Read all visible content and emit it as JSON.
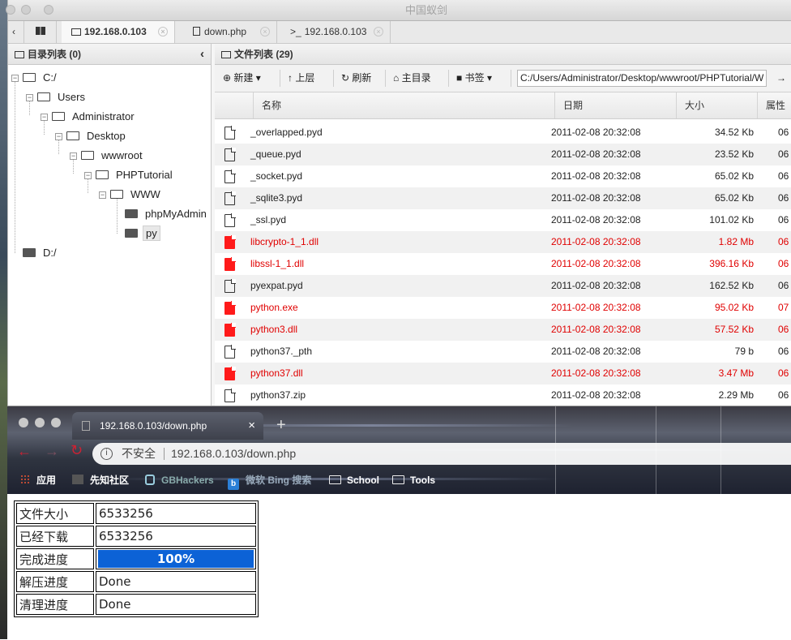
{
  "antsword": {
    "title": "中国蚁剑",
    "tabs": [
      {
        "label": "192.168.0.103"
      },
      {
        "label": "down.php"
      },
      {
        "label": "192.168.0.103"
      }
    ],
    "dir_panel": {
      "title": "目录列表 (0)",
      "tree": [
        {
          "label": "C:/"
        },
        {
          "label": "Users"
        },
        {
          "label": "Administrator"
        },
        {
          "label": "Desktop"
        },
        {
          "label": "wwwroot"
        },
        {
          "label": "PHPTutorial"
        },
        {
          "label": "WWW"
        },
        {
          "label": "phpMyAdmin"
        },
        {
          "label": "py"
        },
        {
          "label": "D:/"
        }
      ]
    },
    "file_panel": {
      "title": "文件列表 (29)",
      "toolbar": {
        "new_label": "新建",
        "up_label": "上层",
        "refresh_label": "刷新",
        "home_label": "主目录",
        "bookmark_label": "书签",
        "path": "C:/Users/Administrator/Desktop/wwwroot/PHPTutorial/W"
      },
      "columns": [
        "名称",
        "日期",
        "大小",
        "属性"
      ],
      "files": [
        {
          "name": "_overlapped.pyd",
          "date": "2011-02-08 20:32:08",
          "size": "34.52 Kb",
          "attr": "06",
          "red": false
        },
        {
          "name": "_queue.pyd",
          "date": "2011-02-08 20:32:08",
          "size": "23.52 Kb",
          "attr": "06",
          "red": false
        },
        {
          "name": "_socket.pyd",
          "date": "2011-02-08 20:32:08",
          "size": "65.02 Kb",
          "attr": "06",
          "red": false
        },
        {
          "name": "_sqlite3.pyd",
          "date": "2011-02-08 20:32:08",
          "size": "65.02 Kb",
          "attr": "06",
          "red": false
        },
        {
          "name": "_ssl.pyd",
          "date": "2011-02-08 20:32:08",
          "size": "101.02 Kb",
          "attr": "06",
          "red": false
        },
        {
          "name": "libcrypto-1_1.dll",
          "date": "2011-02-08 20:32:08",
          "size": "1.82 Mb",
          "attr": "06",
          "red": true
        },
        {
          "name": "libssl-1_1.dll",
          "date": "2011-02-08 20:32:08",
          "size": "396.16 Kb",
          "attr": "06",
          "red": true
        },
        {
          "name": "pyexpat.pyd",
          "date": "2011-02-08 20:32:08",
          "size": "162.52 Kb",
          "attr": "06",
          "red": false
        },
        {
          "name": "python.exe",
          "date": "2011-02-08 20:32:08",
          "size": "95.02 Kb",
          "attr": "07",
          "red": true
        },
        {
          "name": "python3.dll",
          "date": "2011-02-08 20:32:08",
          "size": "57.52 Kb",
          "attr": "06",
          "red": true
        },
        {
          "name": "python37._pth",
          "date": "2011-02-08 20:32:08",
          "size": "79 b",
          "attr": "06",
          "red": false
        },
        {
          "name": "python37.dll",
          "date": "2011-02-08 20:32:08",
          "size": "3.47 Mb",
          "attr": "06",
          "red": true
        },
        {
          "name": "python37.zip",
          "date": "2011-02-08 20:32:08",
          "size": "2.29 Mb",
          "attr": "06",
          "red": false
        }
      ]
    }
  },
  "chrome": {
    "tab_title": "192.168.0.103/down.php",
    "security_label": "不安全",
    "url": "192.168.0.103/down.php",
    "bookmarks": [
      {
        "label": "应用",
        "icon": "apps-grid-icon"
      },
      {
        "label": "先知社区",
        "icon": "xz-icon"
      },
      {
        "label": "GBHackers",
        "icon": "gbhackers-icon"
      },
      {
        "label": "微软 Bing 搜索",
        "icon": "bing-icon"
      },
      {
        "label": "School",
        "icon": "folder-icon"
      },
      {
        "label": "Tools",
        "icon": "folder-icon"
      }
    ]
  },
  "download": {
    "rows": [
      {
        "key": "文件大小",
        "value": "6533256"
      },
      {
        "key": "已经下载",
        "value": "6533256"
      },
      {
        "key": "完成进度",
        "value": "100%",
        "progress": 1.0
      },
      {
        "key": "解压进度",
        "value": "Done"
      },
      {
        "key": "清理进度",
        "value": "Done"
      }
    ]
  },
  "colors": {
    "accent_red": "#e00000",
    "progress_blue": "#0c62d6"
  }
}
